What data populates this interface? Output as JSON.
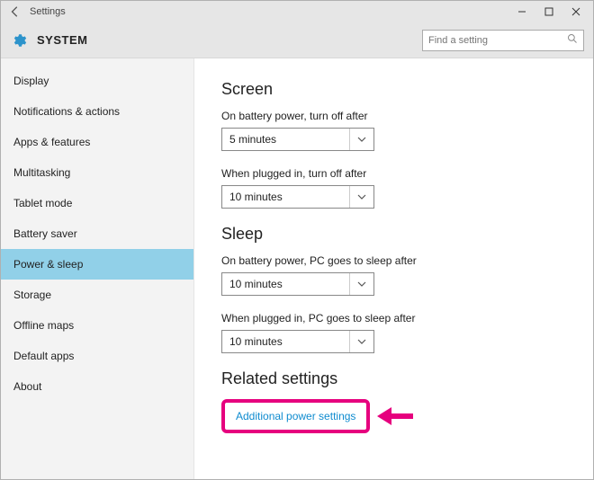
{
  "titlebar": {
    "title": "Settings"
  },
  "header": {
    "label": "SYSTEM",
    "search_placeholder": "Find a setting"
  },
  "sidebar": {
    "items": [
      {
        "label": "Display"
      },
      {
        "label": "Notifications & actions"
      },
      {
        "label": "Apps & features"
      },
      {
        "label": "Multitasking"
      },
      {
        "label": "Tablet mode"
      },
      {
        "label": "Battery saver"
      },
      {
        "label": "Power & sleep",
        "selected": true
      },
      {
        "label": "Storage"
      },
      {
        "label": "Offline maps"
      },
      {
        "label": "Default apps"
      },
      {
        "label": "About"
      }
    ]
  },
  "main": {
    "screen": {
      "title": "Screen",
      "battery_label": "On battery power, turn off after",
      "battery_value": "5 minutes",
      "plugged_label": "When plugged in, turn off after",
      "plugged_value": "10 minutes"
    },
    "sleep": {
      "title": "Sleep",
      "battery_label": "On battery power, PC goes to sleep after",
      "battery_value": "10 minutes",
      "plugged_label": "When plugged in, PC goes to sleep after",
      "plugged_value": "10 minutes"
    },
    "related": {
      "title": "Related settings",
      "link": "Additional power settings"
    }
  }
}
